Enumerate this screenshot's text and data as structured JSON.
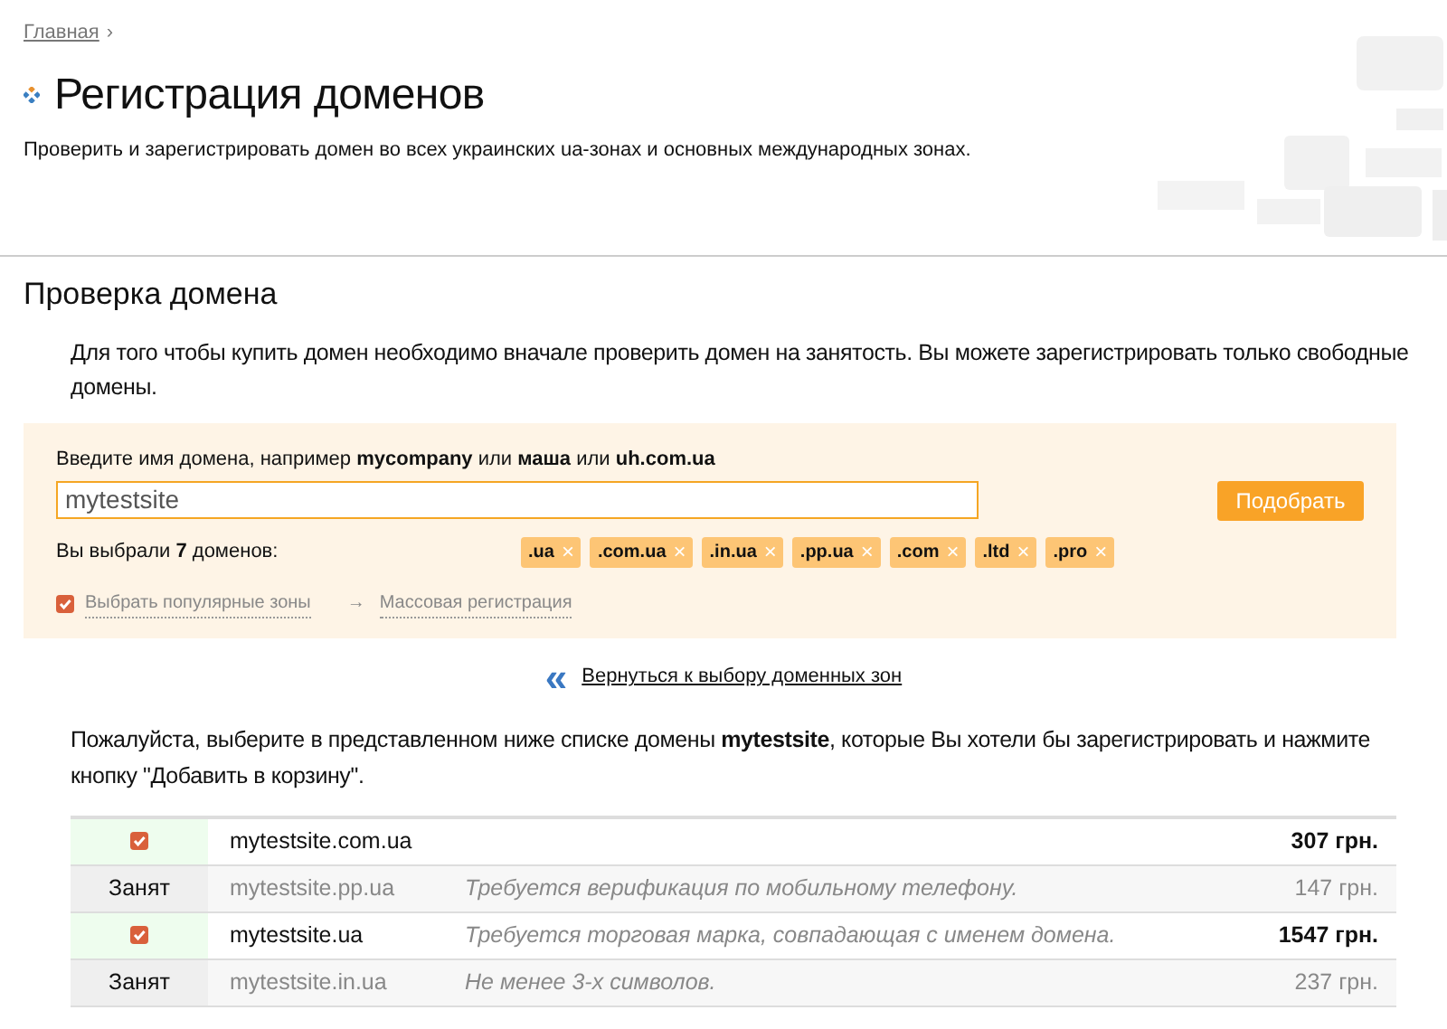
{
  "breadcrumb": {
    "link": "Главная",
    "separator": "›"
  },
  "title": "Регистрация доменов",
  "subtitle": "Проверить и зарегистрировать домен во всех украинских ua-зонах и основных международных зонах.",
  "section_title": "Проверка домена",
  "intro": "Для того чтобы купить домен необходимо вначале проверить домен на занятость. Вы можете зарегистрировать только свободные домены.",
  "search": {
    "hint": "Введите имя домена, например **mycompany** или **маша** или **uh.com.ua**",
    "value": "mytestsite",
    "button": "Подобрать",
    "selected_label": "Вы выбрали **7** доменов:",
    "zones": [
      {
        "label": ".ua",
        "remove": "×"
      },
      {
        "label": ".com.ua",
        "remove": "×"
      },
      {
        "label": ".in.ua",
        "remove": "×"
      },
      {
        "label": ".pp.ua",
        "remove": "×"
      },
      {
        "label": ".com",
        "remove": "×"
      },
      {
        "label": ".ltd",
        "remove": "×"
      },
      {
        "label": ".pro",
        "remove": "×"
      }
    ],
    "popular": {
      "label": "Выбрать популярные зоны",
      "checked": true
    },
    "bulk": {
      "arrow": "→",
      "label": "Массовая регистрация"
    }
  },
  "back": {
    "icon": "«",
    "label": "Вернуться к выбору доменных зон"
  },
  "instructions": "Пожалуйста, выберите в представленном ниже списке домены **mytestsite**, которые Вы хотели бы зарегистрировать и нажмите кнопку \"Добавить в корзину\".",
  "results": [
    {
      "kind": "free",
      "checked": true,
      "domain": "mytestsite.com.ua",
      "price": "307 грн."
    },
    {
      "kind": "taken",
      "status": "Занят",
      "domain": "mytestsite.pp.ua",
      "note": "Требуется верификация по мобильному телефону.",
      "price": "147 грн."
    },
    {
      "kind": "free",
      "checked": true,
      "domain": "mytestsite.ua",
      "note": "Требуется торговая марка, совпадающая с именем домена.",
      "price": "1547 грн."
    },
    {
      "kind": "taken",
      "status": "Занят",
      "domain": "mytestsite.in.ua",
      "note": "Не менее 3-х символов.",
      "price": "237 грн."
    }
  ]
}
